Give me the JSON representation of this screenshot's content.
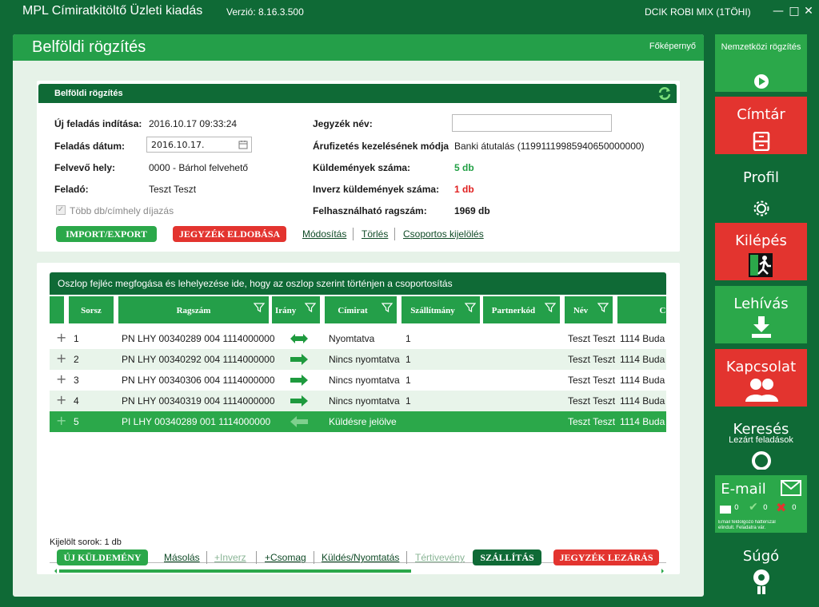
{
  "window": {
    "app_title": "MPL Címiratkitöltő Üzleti kiadás",
    "version": "Verzió: 8.16.3.500",
    "user": "DCIK ROBI MIX (1TÖHI)"
  },
  "panel": {
    "title": "Belföldi rögzítés",
    "home_link": "Főképernyő"
  },
  "form": {
    "header": "Belföldi rögzítés",
    "new_start_label": "Új feladás indítása:",
    "new_start_value": "2016.10.17 09:33:24",
    "date_label": "Feladás dátum:",
    "date_value": "2016.10.17.",
    "pickup_label": "Felvevő hely:",
    "pickup_value": "0000 - Bárhol felvehető",
    "sender_label": "Feladó:",
    "sender_value": "Teszt Teszt",
    "multi_label": "Több db/címhely díjazás",
    "list_name_label": "Jegyzék név:",
    "list_name_value": "",
    "payment_label": "Árufizetés kezelésének módja",
    "payment_value": "Banki átutalás (11991119985940650000000)",
    "count_label": "Küldemények száma:",
    "count_value": "5 db",
    "inverse_label": "Inverz küldemények száma:",
    "inverse_value": "1 db",
    "avail_label": "Felhasználható ragszám:",
    "avail_value": "1969 db",
    "btn_import": "IMPORT/EXPORT",
    "btn_discard": "JEGYZÉK ELDOBÁSA",
    "link_modify": "Módosítás",
    "link_delete": "Törlés",
    "link_group": "Csoportos kijelölés"
  },
  "grid": {
    "group_hint": "Oszlop fejléc megfogása és lehelyezése ide, hogy az oszlop szerint történjen a csoportosítás",
    "columns": [
      "Sorsz",
      "Ragszám",
      "Irány",
      "Címirat",
      "Szállítmány",
      "Partnerkód",
      "Név",
      "C"
    ],
    "rows": [
      {
        "n": "1",
        "rag": "PN LHY 00340289 004 1114000000",
        "dir": "both",
        "cim": "Nyomtatva",
        "szall": "1",
        "nev": "Teszt Teszt",
        "cim2": "1114 Buda"
      },
      {
        "n": "2",
        "rag": "PN LHY 00340292 004 1114000000",
        "dir": "right",
        "cim": "Nincs nyomtatva",
        "szall": "1",
        "nev": "Teszt Teszt",
        "cim2": "1114 Buda"
      },
      {
        "n": "3",
        "rag": "PN LHY 00340306 004 1114000000",
        "dir": "right",
        "cim": "Nincs nyomtatva",
        "szall": "1",
        "nev": "Teszt Teszt",
        "cim2": "1114 Buda"
      },
      {
        "n": "4",
        "rag": "PN LHY 00340319 004 1114000000",
        "dir": "right",
        "cim": "Nincs nyomtatva",
        "szall": "1",
        "nev": "Teszt Teszt",
        "cim2": "1114 Buda"
      },
      {
        "n": "5",
        "rag": "PI LHY 00340289 001 1114000000",
        "dir": "left",
        "cim": "Küldésre jelölve",
        "szall": "",
        "nev": "Teszt Teszt",
        "cim2": "1114 Buda"
      }
    ],
    "selected_info": "Kijelölt sorok: 1 db"
  },
  "bottom": {
    "btn_new": "ÚJ KÜLDEMÉNY",
    "link_copy": "Másolás",
    "link_inverse": "+Inverz",
    "link_package": "+Csomag",
    "link_send": "Küldés/Nyomtatás",
    "link_return": "Tértivevény",
    "btn_ship": "SZÁLLÍTÁS",
    "btn_close": "JEGYZÉK LEZÁRÁS"
  },
  "sidebar": {
    "intl": "Nemzetközi rögzítés",
    "cimtar": "Címtár",
    "profil": "Profil",
    "kilepes": "Kilépés",
    "lehivas": "Lehívás",
    "kapcsolat": "Kapcsolat",
    "kereses": "Keresés",
    "kereses_sub": "Lezárt feladások",
    "email": "E-mail",
    "email_counts": [
      "0",
      "0",
      "0"
    ],
    "email_note": "Email feldolgozó háttérszál elindult. Feladatra vár.",
    "sugo": "Súgó"
  }
}
